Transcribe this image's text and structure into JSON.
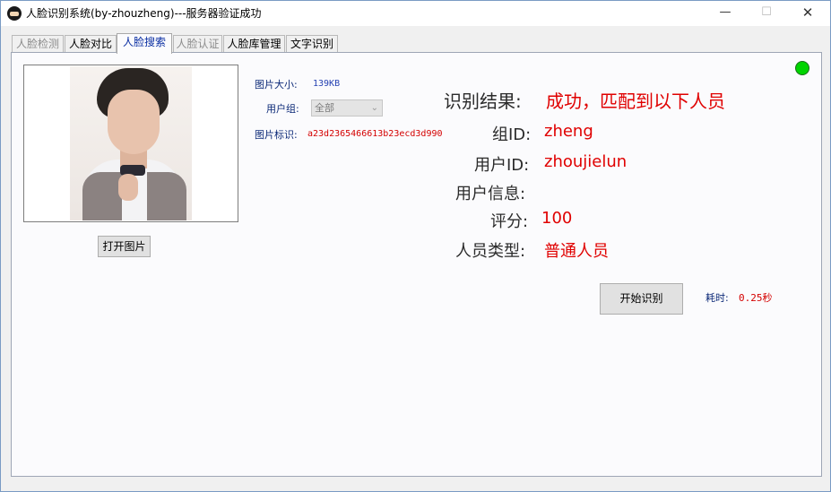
{
  "window": {
    "title": "人脸识别系统(by-zhouzheng)---服务器验证成功",
    "min_icon": "—",
    "max_icon": "☐",
    "close_icon": "✕"
  },
  "tabs": [
    {
      "label": "人脸检测",
      "state": "disabled"
    },
    {
      "label": "人脸对比",
      "state": "normal"
    },
    {
      "label": "人脸搜索",
      "state": "active"
    },
    {
      "label": "人脸认证",
      "state": "disabled"
    },
    {
      "label": "人脸库管理",
      "state": "normal"
    },
    {
      "label": "文字识别",
      "state": "normal"
    }
  ],
  "image_panel": {
    "open_button": "打开图片"
  },
  "info": {
    "size_label": "图片大小:",
    "size_value": "139KB",
    "group_label": "用户组:",
    "group_value": "全部",
    "token_label": "图片标识:",
    "token_value": "a23d2365466613b23ecd3d990"
  },
  "result": {
    "title_label": "识别结果:",
    "title_value": "成功，匹配到以下人员",
    "group_id_label": "组ID:",
    "group_id_value": "zheng",
    "user_id_label": "用户ID:",
    "user_id_value": "zhoujielun",
    "user_info_label": "用户信息:",
    "user_info_value": "",
    "score_label": "评分:",
    "score_value": "100",
    "type_label": "人员类型:",
    "type_value": "普通人员"
  },
  "actions": {
    "start_button": "开始识别",
    "time_label": "耗时:",
    "time_value": "0.25秒"
  },
  "colors": {
    "status": "#00d400",
    "result_value": "#e00000",
    "active_tab": "#0b2fa3"
  }
}
